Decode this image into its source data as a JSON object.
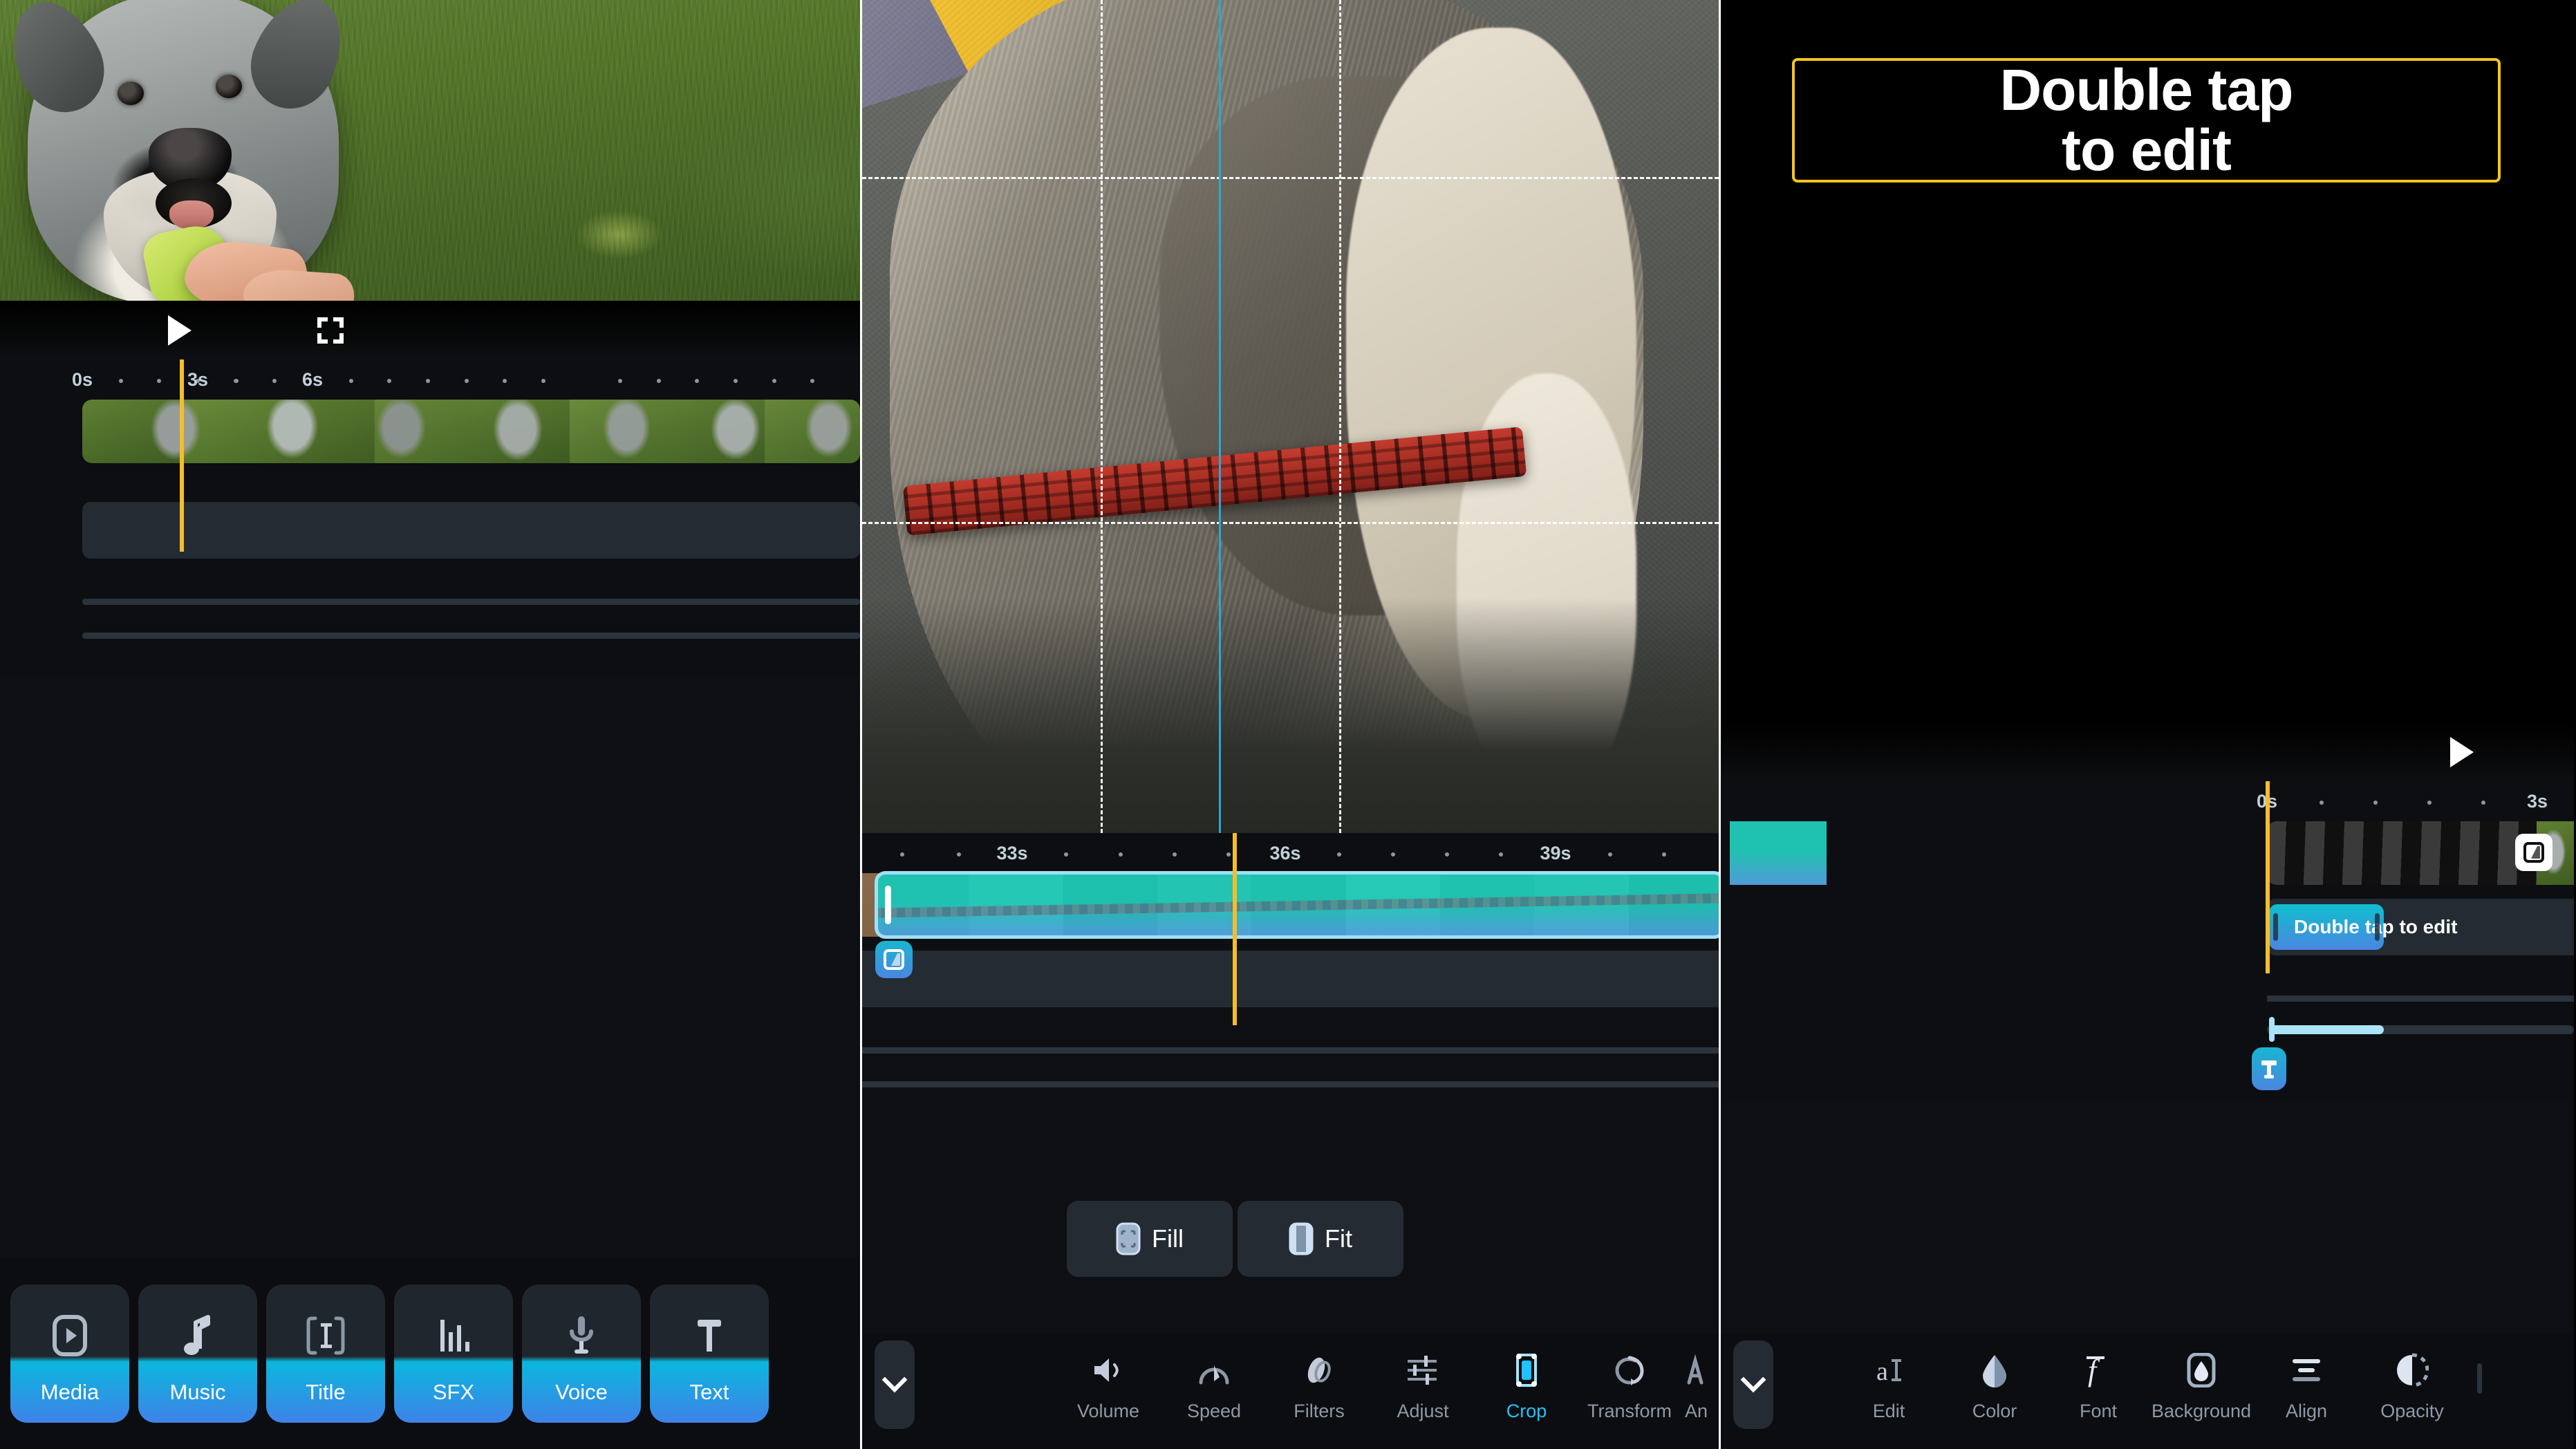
{
  "panels": {
    "left": {
      "name": "media-panel",
      "playback": {
        "play_icon": "play-icon",
        "fullscreen_icon": "fullscreen-icon"
      },
      "ruler": {
        "labels": [
          "0s",
          "3s",
          "6s"
        ]
      },
      "tiles": [
        {
          "label": "Media",
          "icon": "media-icon"
        },
        {
          "label": "Music",
          "icon": "music-note-icon"
        },
        {
          "label": "Title",
          "icon": "title-icon"
        },
        {
          "label": "SFX",
          "icon": "sfx-bars-icon"
        },
        {
          "label": "Voice",
          "icon": "microphone-icon"
        },
        {
          "label": "Text",
          "icon": "text-t-icon"
        }
      ]
    },
    "mid": {
      "name": "crop-panel",
      "ruler": {
        "labels": [
          "33s",
          "36s",
          "39s"
        ]
      },
      "transition_badge": "transition-icon",
      "aspect_buttons": [
        {
          "label": "Fill",
          "icon": "fill-icon"
        },
        {
          "label": "Fit",
          "icon": "fit-icon"
        }
      ],
      "toolbar": {
        "collapse_icon": "chevron-down-icon",
        "items": [
          {
            "label": "Volume",
            "icon": "volume-icon",
            "active": false
          },
          {
            "label": "Speed",
            "icon": "speed-icon",
            "active": false
          },
          {
            "label": "Filters",
            "icon": "filters-icon",
            "active": false
          },
          {
            "label": "Adjust",
            "icon": "adjust-icon",
            "active": false
          },
          {
            "label": "Crop",
            "icon": "crop-icon",
            "active": true
          },
          {
            "label": "Transform",
            "icon": "transform-icon",
            "active": false
          },
          {
            "label": "An",
            "icon": "animation-icon",
            "active": false
          }
        ]
      }
    },
    "right": {
      "name": "text-panel",
      "preview_text_line1": "Double tap",
      "preview_text_line2": "to edit",
      "text_box_border_color": "#f5c518",
      "playback": {
        "play_icon": "play-icon",
        "fullscreen_icon": "fullscreen-icon"
      },
      "ruler": {
        "labels": [
          "0s",
          "3s"
        ]
      },
      "clip_badge": "transition-icon",
      "text_clip_label": "Double tap to edit",
      "text_badge": "text-t-icon",
      "toolbar": {
        "collapse_icon": "chevron-down-icon",
        "items": [
          {
            "label": "Edit",
            "icon": "edit-text-icon",
            "active": false
          },
          {
            "label": "Color",
            "icon": "color-drop-icon",
            "active": false
          },
          {
            "label": "Font",
            "icon": "font-f-icon",
            "active": false
          },
          {
            "label": "Background",
            "icon": "background-icon",
            "active": false
          },
          {
            "label": "Align",
            "icon": "align-icon",
            "active": false
          },
          {
            "label": "Opacity",
            "icon": "opacity-icon",
            "active": false
          }
        ]
      }
    }
  },
  "colors": {
    "accent_blue": "#1ec4ff",
    "playhead_yellow": "#f5bd2a",
    "selection_cyan": "#9fe0f5",
    "panel_bg": "#0c0e11",
    "tile_blue": "#3f82e8"
  }
}
